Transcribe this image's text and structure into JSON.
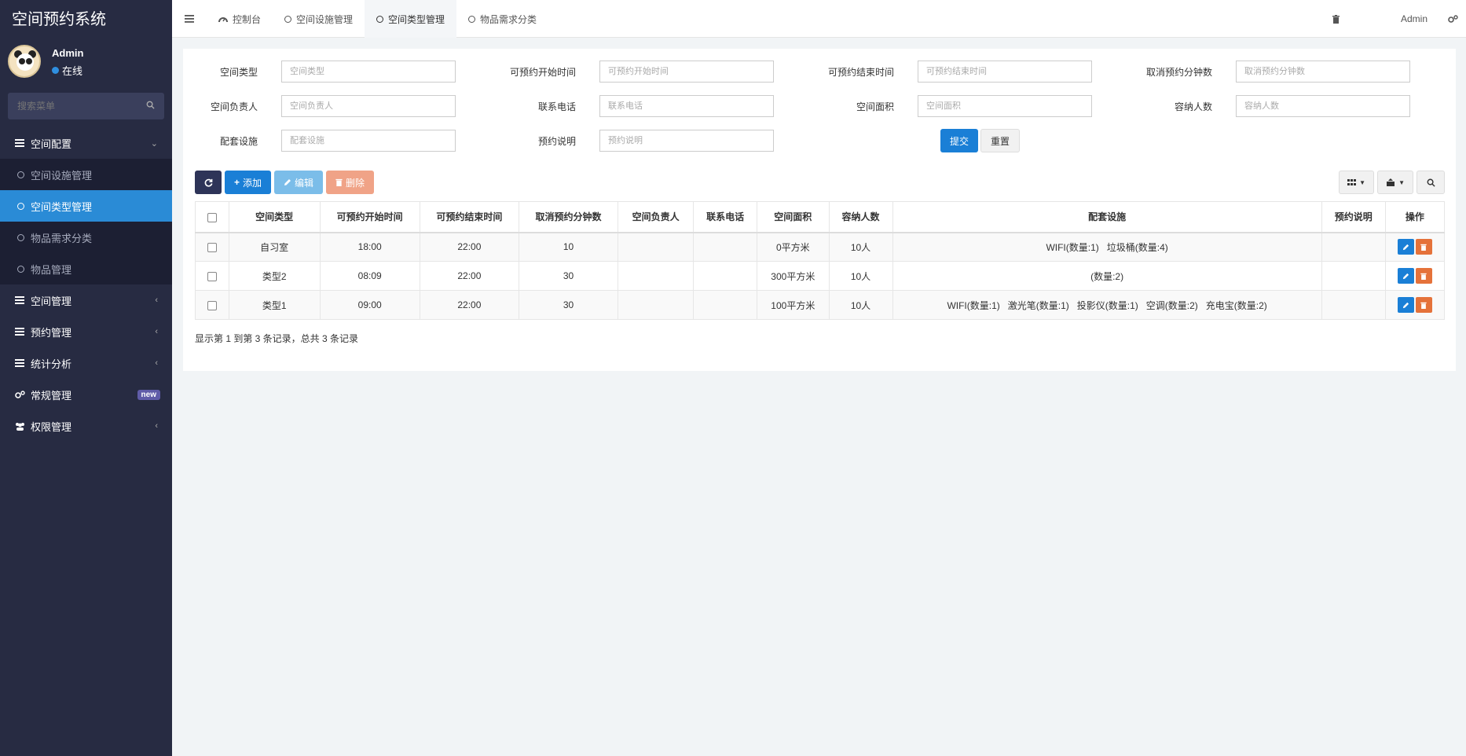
{
  "app": {
    "title": "空间预约系统"
  },
  "user": {
    "name": "Admin",
    "status": "在线"
  },
  "sidebar": {
    "search_placeholder": "搜索菜单",
    "menu": [
      {
        "label": "空间配置"
      },
      {
        "label": "空间管理"
      },
      {
        "label": "预约管理"
      },
      {
        "label": "统计分析"
      },
      {
        "label": "常规管理",
        "badge": "new"
      },
      {
        "label": "权限管理"
      }
    ],
    "submenu": [
      {
        "label": "空间设施管理"
      },
      {
        "label": "空间类型管理"
      },
      {
        "label": "物品需求分类"
      },
      {
        "label": "物品管理"
      }
    ]
  },
  "topnav": {
    "tabs": [
      {
        "label": "控制台"
      },
      {
        "label": "空间设施管理"
      },
      {
        "label": "空间类型管理"
      },
      {
        "label": "物品需求分类"
      }
    ],
    "user": "Admin"
  },
  "form": {
    "fields": [
      {
        "label": "空间类型",
        "placeholder": "空间类型"
      },
      {
        "label": "可预约开始时间",
        "placeholder": "可预约开始时间"
      },
      {
        "label": "可预约结束时间",
        "placeholder": "可预约结束时间"
      },
      {
        "label": "取消预约分钟数",
        "placeholder": "取消预约分钟数"
      },
      {
        "label": "空间负责人",
        "placeholder": "空间负责人"
      },
      {
        "label": "联系电话",
        "placeholder": "联系电话"
      },
      {
        "label": "空间面积",
        "placeholder": "空间面积"
      },
      {
        "label": "容纳人数",
        "placeholder": "容纳人数"
      },
      {
        "label": "配套设施",
        "placeholder": "配套设施"
      },
      {
        "label": "预约说明",
        "placeholder": "预约说明"
      }
    ],
    "submit": "提交",
    "reset": "重置"
  },
  "toolbar": {
    "add": "添加",
    "edit": "编辑",
    "delete": "删除"
  },
  "table": {
    "headers": [
      "空间类型",
      "可预约开始时间",
      "可预约结束时间",
      "取消预约分钟数",
      "空间负责人",
      "联系电话",
      "空间面积",
      "容纳人数",
      "配套设施",
      "预约说明",
      "操作"
    ],
    "rows": [
      [
        "自习室",
        "18:00",
        "22:00",
        "10",
        "",
        "",
        "0平方米",
        "10人",
        "WIFI(数量:1)   垃圾桶(数量:4)",
        ""
      ],
      [
        "类型2",
        "08:09",
        "22:00",
        "30",
        "",
        "",
        "300平方米",
        "10人",
        "(数量:2)",
        ""
      ],
      [
        "类型1",
        "09:00",
        "22:00",
        "30",
        "",
        "",
        "100平方米",
        "10人",
        "WIFI(数量:1)   激光笔(数量:1)   投影仪(数量:1)   空调(数量:2)   充电宝(数量:2)",
        ""
      ]
    ]
  },
  "pager": {
    "text": "显示第 1 到第 3 条记录，总共 3 条记录"
  }
}
